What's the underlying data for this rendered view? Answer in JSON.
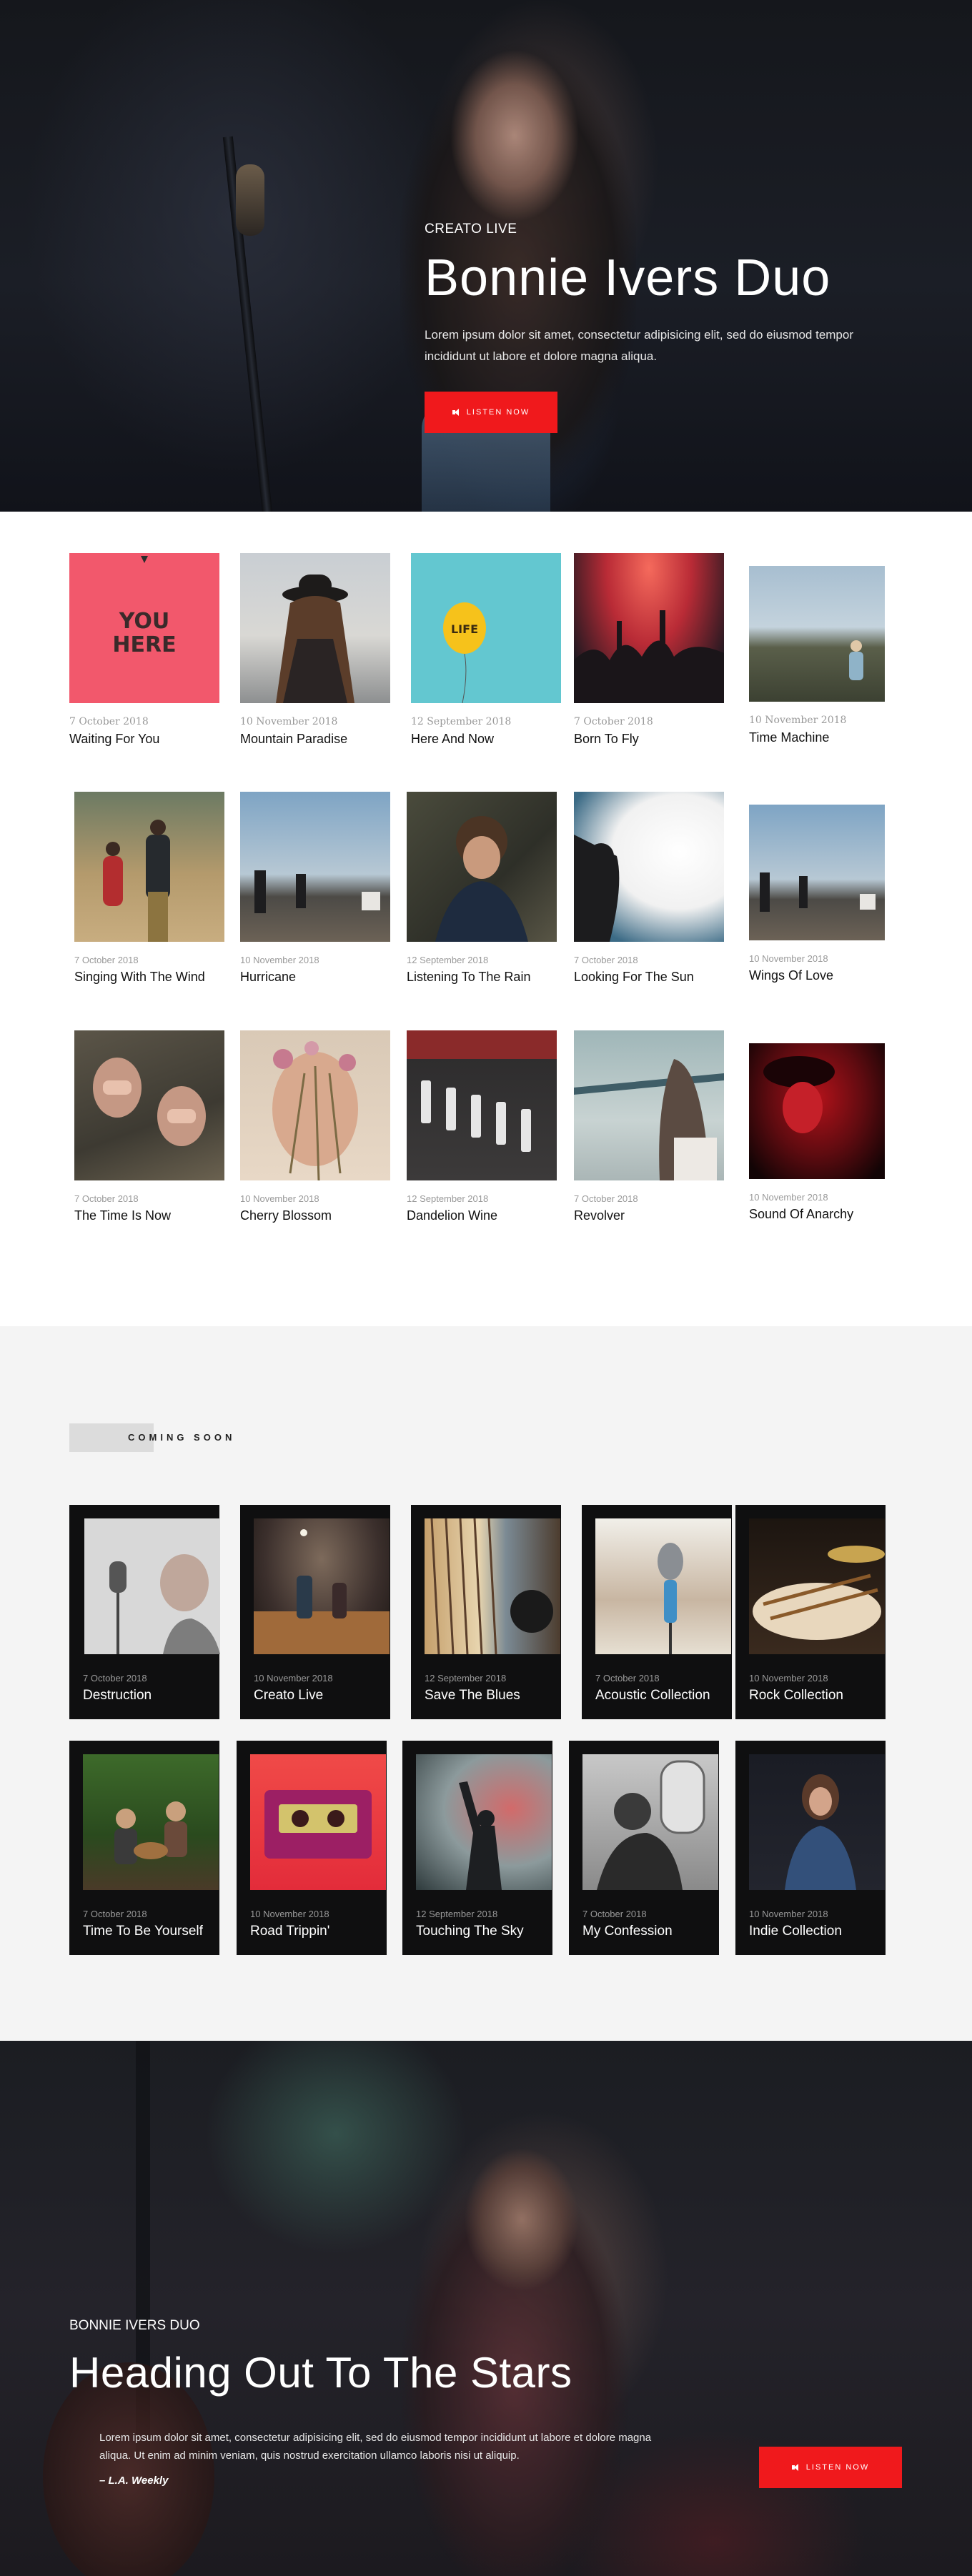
{
  "hero": {
    "eyebrow": "CREATO LIVE",
    "title": "Bonnie Ivers Duo",
    "description": "Lorem ipsum dolor sit amet, consectetur adipisicing elit, sed do eiusmod tempor incididunt ut labore et dolore magna aliqua.",
    "button_label": "LISTEN NOW",
    "button_icon": "speaker-icon"
  },
  "albums": [
    {
      "date": "7 October 2018",
      "title": "Waiting For You"
    },
    {
      "date": "10 November 2018",
      "title": "Mountain Paradise"
    },
    {
      "date": "12 September 2018",
      "title": "Here And Now"
    },
    {
      "date": "7 October 2018",
      "title": "Born To Fly"
    },
    {
      "date": "10 November 2018",
      "title": "Time Machine"
    },
    {
      "date": "7 October 2018",
      "title": "Singing With The Wind"
    },
    {
      "date": "10 November 2018",
      "title": "Hurricane"
    },
    {
      "date": "12 September 2018",
      "title": "Listening To The Rain"
    },
    {
      "date": "7 October 2018",
      "title": "Looking For The Sun"
    },
    {
      "date": "10 November 2018",
      "title": "Wings Of Love"
    },
    {
      "date": "7 October 2018",
      "title": "The Time Is Now"
    },
    {
      "date": "10 November 2018",
      "title": "Cherry Blossom"
    },
    {
      "date": "12 September 2018",
      "title": "Dandelion Wine"
    },
    {
      "date": "7 October 2018",
      "title": "Revolver"
    },
    {
      "date": "10 November 2018",
      "title": "Sound Of Anarchy"
    }
  ],
  "coming_soon": {
    "label": "COMING SOON",
    "items": [
      {
        "date": "7 October 2018",
        "title": "Destruction"
      },
      {
        "date": "10 November 2018",
        "title": "Creato Live"
      },
      {
        "date": "12 September 2018",
        "title": "Save The Blues"
      },
      {
        "date": "7 October 2018",
        "title": "Acoustic Collection"
      },
      {
        "date": "10 November 2018",
        "title": "Rock Collection"
      },
      {
        "date": "7 October 2018",
        "title": "Time To Be Yourself"
      },
      {
        "date": "10 November 2018",
        "title": "Road Trippin'"
      },
      {
        "date": "12 September 2018",
        "title": "Touching The Sky"
      },
      {
        "date": "7 October 2018",
        "title": "My Confession"
      },
      {
        "date": "10 November 2018",
        "title": "Indie Collection"
      }
    ]
  },
  "feature": {
    "eyebrow": "BONNIE IVERS DUO",
    "title": "Heading Out To The Stars",
    "description": "Lorem ipsum dolor sit amet, consectetur adipisicing elit, sed do eiusmod tempor incididunt ut labore et dolore magna aliqua. Ut enim ad minim veniam, quis nostrud exercitation ullamco laboris nisi ut aliquip.",
    "quote_source": "– L.A. Weekly",
    "button_label": "LISTEN NOW",
    "button_icon": "speaker-icon"
  },
  "colors": {
    "accent": "#f0191c",
    "card_bg": "#0f0f10",
    "section_bg": "#f4f4f4"
  }
}
